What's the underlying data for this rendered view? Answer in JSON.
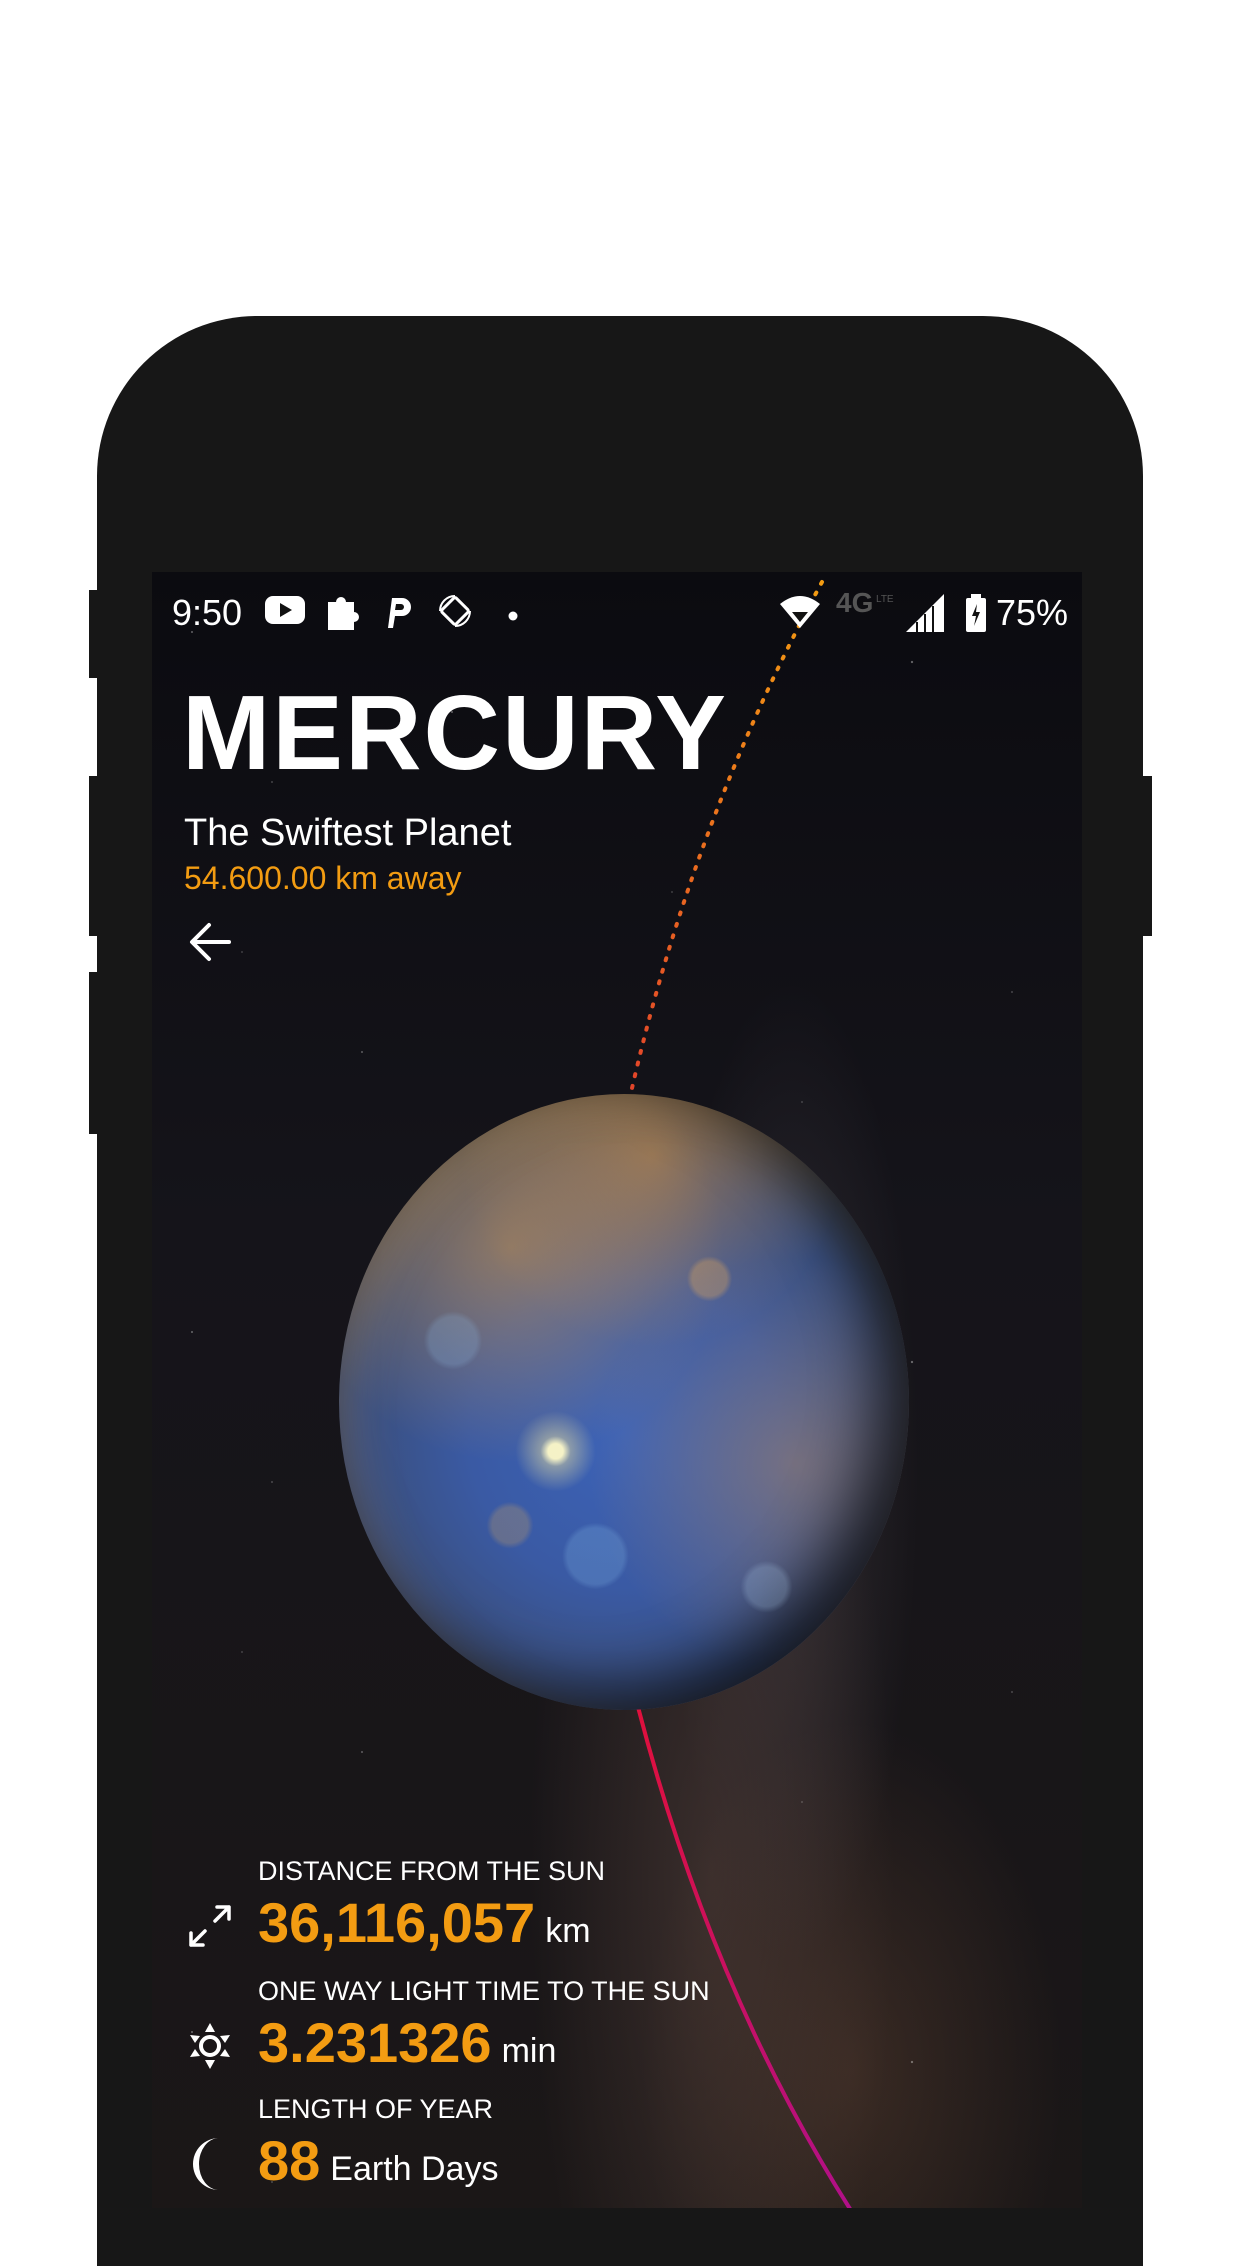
{
  "status_bar": {
    "time": "9:50",
    "battery": "75%",
    "network": "4G LTE",
    "left_icons": [
      "youtube-icon",
      "puzzle-icon",
      "p-app-icon",
      "rotate-icon",
      "dot-icon"
    ],
    "right_icons": [
      "wifi-icon",
      "lte-icon",
      "signal-icon",
      "battery-icon"
    ]
  },
  "header": {
    "title": "MERCURY",
    "subtitle": "The Swiftest Planet",
    "distance_away": "54.600.00 km away"
  },
  "colors": {
    "accent": "#f39c12",
    "text": "#ffffff",
    "orbit_top": "#f39c12",
    "orbit_bottom": "#d4145a"
  },
  "stats": [
    {
      "label": "DISTANCE FROM THE SUN",
      "value": "36,116,057",
      "unit": "km",
      "icon": "expand-arrows-icon"
    },
    {
      "label": "ONE WAY LIGHT TIME TO THE SUN",
      "value": "3.231326",
      "unit": "min",
      "icon": "sun-icon"
    },
    {
      "label": "LENGTH OF YEAR",
      "value": "88",
      "unit": "Earth Days",
      "icon": "moon-icon"
    }
  ]
}
